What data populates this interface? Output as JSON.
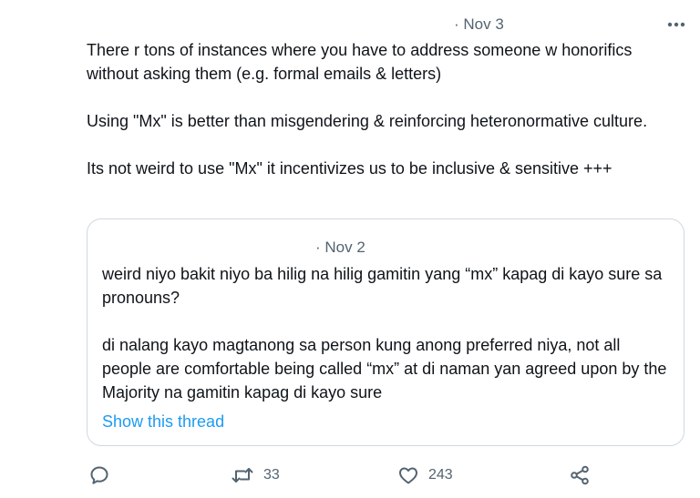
{
  "tweet": {
    "date": "· Nov 3",
    "more_icon": "more-horizontal-icon",
    "paragraphs": [
      "There r tons of instances where you have to address someone w honorifics without asking them (e.g. formal emails & letters)",
      "Using \"Mx\" is better than misgendering & reinforcing heteronormative culture.",
      "Its not weird to use \"Mx\" it incentivizes us to be inclusive & sensitive +++"
    ]
  },
  "quote": {
    "date": "· Nov 2",
    "paragraphs": [
      "weird niyo bakit niyo ba hilig na hilig gamitin yang “mx” kapag di kayo sure sa pronouns?",
      "di nalang kayo magtanong sa person kung anong preferred niya, not all people are comfortable being called “mx” at di naman yan agreed upon by the Majority na gamitin kapag di kayo sure"
    ],
    "show_thread": "Show this thread",
    "link_color": "#1d9bf0"
  },
  "actions": {
    "reply": {
      "icon": "reply-icon",
      "count": ""
    },
    "retweet": {
      "icon": "retweet-icon",
      "count": "33"
    },
    "like": {
      "icon": "heart-icon",
      "count": "243"
    },
    "share": {
      "icon": "share-icon"
    }
  },
  "colors": {
    "text": "#0f1419",
    "muted": "#536471",
    "border": "#cfd9de"
  }
}
